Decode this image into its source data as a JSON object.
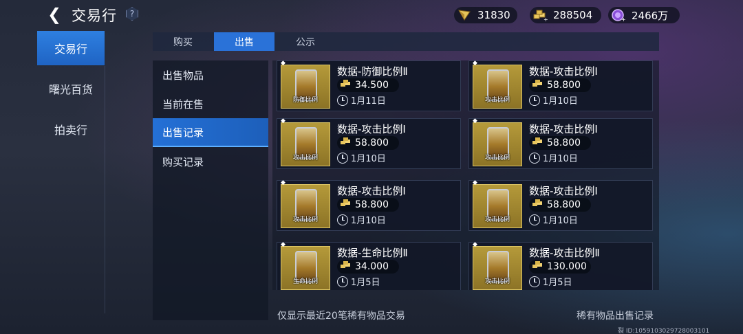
{
  "header": {
    "title": "交易行",
    "help_label": "?",
    "currencies": [
      {
        "icon": "crystal-icon",
        "value": "31830"
      },
      {
        "icon": "gold-bars-icon",
        "value": "288504"
      },
      {
        "icon": "purple-coin-icon",
        "value": "2466万"
      }
    ]
  },
  "left_nav": {
    "items": [
      {
        "label": "交易行",
        "active": true
      },
      {
        "label": "曙光百货",
        "active": false
      },
      {
        "label": "拍卖行",
        "active": false
      }
    ]
  },
  "tabs": [
    {
      "label": "购买",
      "active": false
    },
    {
      "label": "出售",
      "active": true
    },
    {
      "label": "公示",
      "active": false
    }
  ],
  "sub_nav": {
    "items": [
      {
        "label": "出售物品",
        "active": false
      },
      {
        "label": "当前在售",
        "active": false
      },
      {
        "label": "出售记录",
        "active": true
      },
      {
        "label": "购买记录",
        "active": false
      }
    ]
  },
  "records": [
    {
      "name": "数据-防御比例Ⅱ",
      "price": "34.500",
      "date": "1月11日",
      "tag": "防御比例"
    },
    {
      "name": "数据-攻击比例Ⅰ",
      "price": "58.800",
      "date": "1月10日",
      "tag": "攻击比例"
    },
    {
      "name": "数据-攻击比例Ⅰ",
      "price": "58.800",
      "date": "1月10日",
      "tag": "攻击比例"
    },
    {
      "name": "数据-攻击比例Ⅰ",
      "price": "58.800",
      "date": "1月10日",
      "tag": "攻击比例"
    },
    {
      "name": "数据-攻击比例Ⅰ",
      "price": "58.800",
      "date": "1月10日",
      "tag": "攻击比例"
    },
    {
      "name": "数据-攻击比例Ⅰ",
      "price": "58.800",
      "date": "1月10日",
      "tag": "攻击比例"
    },
    {
      "name": "数据-生命比例Ⅱ",
      "price": "34.000",
      "date": "1月5日",
      "tag": "生命比例"
    },
    {
      "name": "数据-攻击比例Ⅱ",
      "price": "130.000",
      "date": "1月5日",
      "tag": "攻击比例"
    }
  ],
  "footer": {
    "note": "仅显示最近20笔稀有物品交易",
    "link": "稀有物品出售记录",
    "id_text": "裂 ID:1059103029728003101"
  },
  "colors": {
    "accent": "#2a72d8",
    "gold": "#e7c35a",
    "panel": "#121828"
  }
}
